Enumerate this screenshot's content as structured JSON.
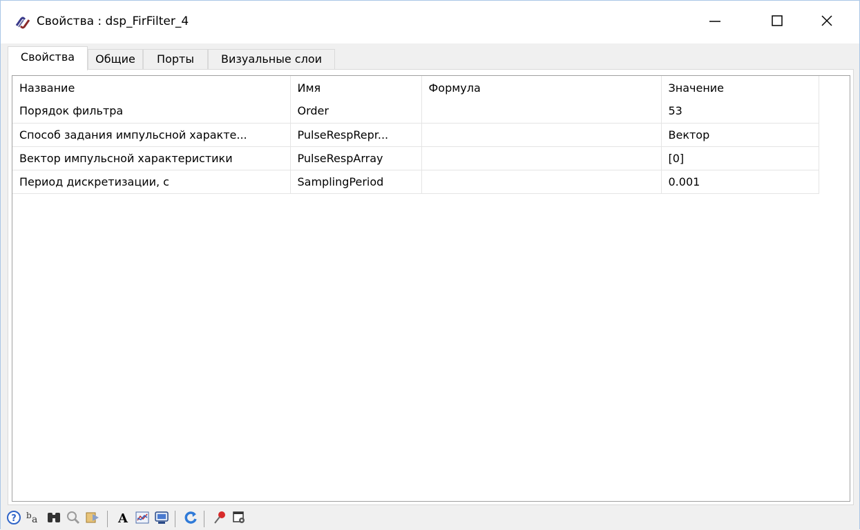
{
  "window": {
    "title": "Свойства : dsp_FirFilter_4",
    "app_icon": "link-chain-icon",
    "controls": [
      "minimize-icon",
      "maximize-icon",
      "close-icon"
    ]
  },
  "tabs": [
    {
      "label": "Свойства",
      "active": true
    },
    {
      "label": "Общие",
      "active": false
    },
    {
      "label": "Порты",
      "active": false
    },
    {
      "label": "Визуальные слои",
      "active": false
    }
  ],
  "table": {
    "headers": [
      "Название",
      "Имя",
      "Формула",
      "Значение"
    ],
    "rows": [
      {
        "name": "Порядок фильтра",
        "id": "Order",
        "formula": "",
        "value": "53"
      },
      {
        "name": "Способ задания импульсной характе...",
        "id": "PulseRespRepr...",
        "formula": "",
        "value": "Вектор"
      },
      {
        "name": "Вектор импульсной характеристики",
        "id": "PulseRespArray",
        "formula": "",
        "value": "[0]"
      },
      {
        "name": "Период дискретизации, с",
        "id": "SamplingPeriod",
        "formula": "",
        "value": "0.001"
      }
    ]
  },
  "toolbar": {
    "icons": [
      "help-icon",
      "sort-alpha-icon",
      "binoculars-icon",
      "zoom-icon",
      "export-icon",
      "font-icon",
      "chart-icon",
      "monitor-icon",
      "refresh-icon",
      "pin-icon",
      "settings-window-icon"
    ]
  },
  "colors": {
    "window_border": "#a9c6e6",
    "background": "#f0f0f0",
    "panel": "#ffffff"
  }
}
